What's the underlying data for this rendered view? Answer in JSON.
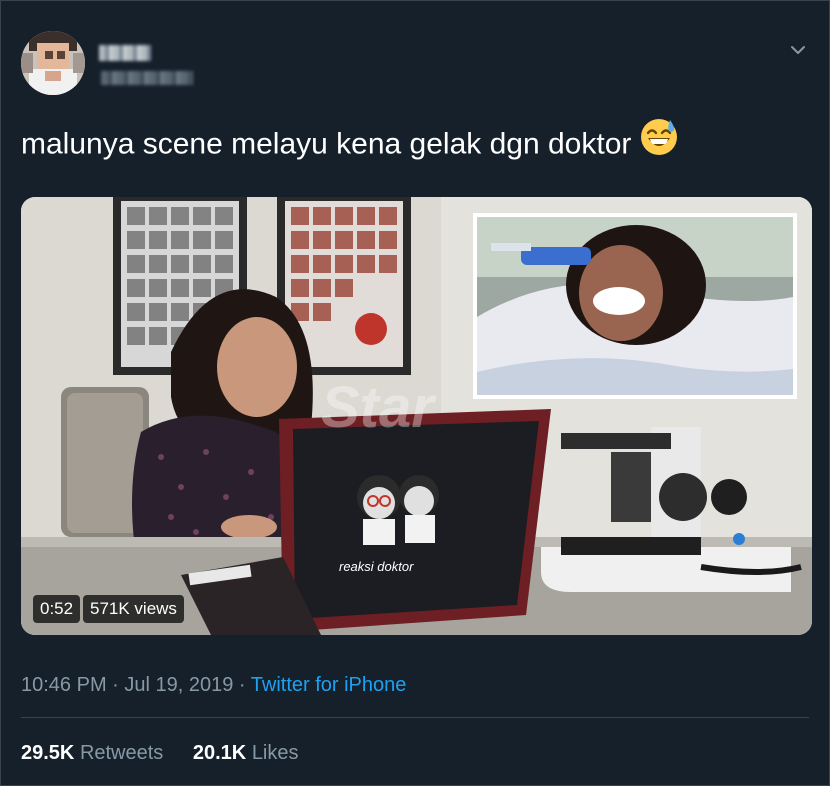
{
  "tweet": {
    "text": "malunya scene melayu kena gelak dgn doktor",
    "emoji": "grinning-face-with-sweat",
    "timestamp": "10:46 PM · Jul 19, 2019 · ",
    "source": "Twitter for iPhone",
    "retweets_count": "29.5K",
    "retweets_label": "Retweets",
    "likes_count": "20.1K",
    "likes_label": "Likes"
  },
  "video": {
    "duration": "0:52",
    "views": "571K views",
    "laptop_sticker": "reaksi doktor"
  },
  "colors": {
    "background": "#15202b",
    "border": "#38444d",
    "secondary_text": "#8899a6",
    "link": "#1da1f2"
  }
}
